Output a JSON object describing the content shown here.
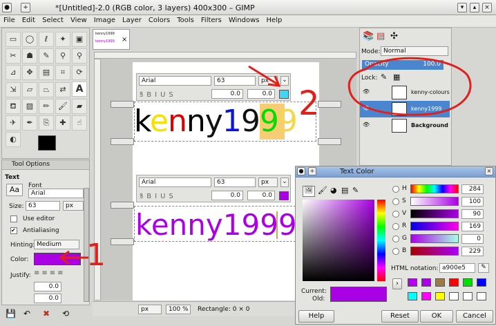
{
  "window": {
    "title": "*[Untitled]-2.0 (RGB color, 3 layers) 400x300 – GIMP"
  },
  "menu": [
    "File",
    "Edit",
    "Select",
    "View",
    "Image",
    "Layer",
    "Colors",
    "Tools",
    "Filters",
    "Windows",
    "Help"
  ],
  "image_tab": {
    "line1": "kenny1999",
    "line2": "kenny1999"
  },
  "tool_options": {
    "tab_label": "Tool Options",
    "section": "Text",
    "font_label": "Font",
    "font_value": "Arial",
    "size_label": "Size:",
    "size_value": "63",
    "size_unit": "px",
    "use_editor": "Use editor",
    "antialiasing": "Antialiasing",
    "hinting_label": "Hinting:",
    "hinting_value": "Medium",
    "color_label": "Color:",
    "justify_label": "Justify:",
    "indent_value": "0.0",
    "spacing_value": "0.0"
  },
  "text_toolbar_top": {
    "font": "Arial",
    "size": "63",
    "unit": "px",
    "baseline": "0.0",
    "kerning": "0.0"
  },
  "text_toolbar_bottom": {
    "font": "Arial",
    "size": "63",
    "unit": "px",
    "baseline": "0.0",
    "kerning": "0.0"
  },
  "canvas": {
    "text_top": "kenny1999",
    "text_bottom": "kenny1999"
  },
  "statusbar": {
    "unit": "px",
    "zoom": "100 %",
    "message": "Rectangle: 0 × 0"
  },
  "layers": {
    "mode_label": "Mode:",
    "mode_value": "Normal",
    "opacity_label": "Opacity",
    "opacity_value": "100.0",
    "lock_label": "Lock:",
    "items": [
      "kenny-colours",
      "kenny1999",
      "Background"
    ]
  },
  "annotations": {
    "one": "1",
    "two": "2"
  },
  "text_color_dialog": {
    "title": "Text Color",
    "channels": [
      {
        "label": "H",
        "value": "284"
      },
      {
        "label": "S",
        "value": "100"
      },
      {
        "label": "V",
        "value": "90"
      },
      {
        "label": "R",
        "value": "169"
      },
      {
        "label": "G",
        "value": "0"
      },
      {
        "label": "B",
        "value": "229"
      }
    ],
    "html_label": "HTML notation:",
    "html_value": "a900e5",
    "current_label": "Current:",
    "old_label": "Old:",
    "help": "Help",
    "reset": "Reset",
    "ok": "OK",
    "cancel": "Cancel"
  },
  "colors": {
    "current": "#a900e5",
    "highlight": "#4a86cf",
    "annotation": "#e0201a",
    "accent_cyan": "#3fd6f5",
    "history": [
      "#b400ee",
      "#a800e6",
      "#9c7b47",
      "#ff0000",
      "#00e000",
      "#0000ff",
      "#00ffff",
      "#ff00ff",
      "#ffff00",
      "#ffffff",
      "#ffffff",
      "#ffffff"
    ]
  }
}
